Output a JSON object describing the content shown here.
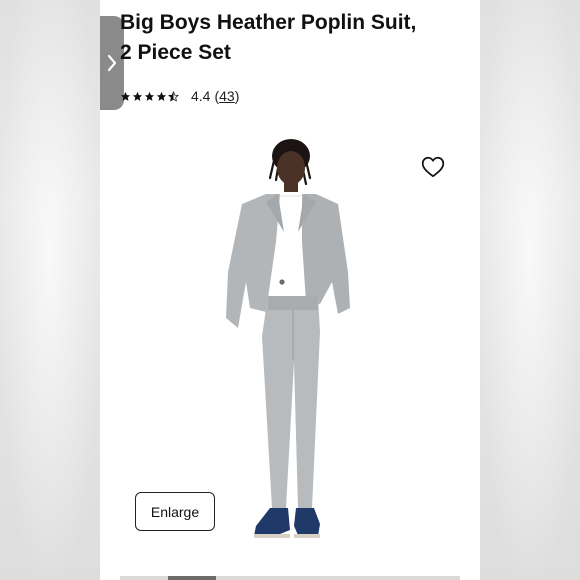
{
  "product": {
    "title_line1": "Big Boys Heather Poplin Suit,",
    "title_line2": "2 Piece Set",
    "rating": {
      "stars": 4.5,
      "value": "4.4",
      "count": "43",
      "open": "(",
      "close": ")"
    }
  },
  "actions": {
    "enlarge_label": "Enlarge"
  },
  "icons": {
    "prev": "chevron-right-icon",
    "wishlist": "heart-outline-icon",
    "star": "star-icon"
  },
  "carousel": {
    "position": 0.14
  },
  "colors": {
    "suit": "#b3b6b8",
    "shirt": "#ffffff",
    "shoes": "#1f3a68",
    "tab": "#8a8a8a"
  }
}
